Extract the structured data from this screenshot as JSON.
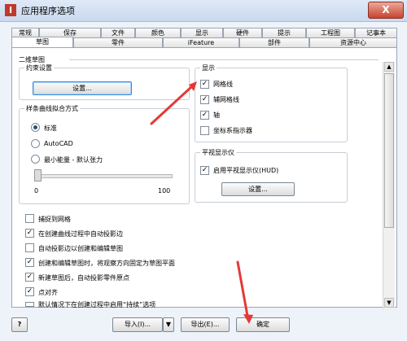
{
  "window": {
    "title": "应用程序选项",
    "close_glyph": "X"
  },
  "tabs_row1": [
    "常规",
    "保存",
    "文件",
    "颜色",
    "显示",
    "硬件",
    "提示",
    "工程图",
    "记事本"
  ],
  "tabs_row2": [
    "草图",
    "零件",
    "iFeature",
    "部件",
    "资源中心"
  ],
  "active_tab": "草图",
  "section_label": "二维草图",
  "constraint": {
    "label": "约束设置",
    "button": "设置..."
  },
  "spline": {
    "label": "样条曲线拟合方式",
    "options": [
      "标准",
      "AutoCAD",
      "最小能量 - 默认张力"
    ],
    "selected": "标准",
    "slider_min": "0",
    "slider_max": "100"
  },
  "display": {
    "label": "显示",
    "items": [
      {
        "label": "网格线",
        "checked": true
      },
      {
        "label": "辅网格线",
        "checked": true
      },
      {
        "label": "轴",
        "checked": true
      },
      {
        "label": "坐标系指示器",
        "checked": false
      }
    ]
  },
  "heads_up": {
    "label": "平视显示仪",
    "checkbox": "启用平视显示仪(HUD)",
    "checked": true,
    "button": "设置..."
  },
  "options": [
    {
      "label": "捕捉到网格",
      "checked": false
    },
    {
      "label": "在创建曲线过程中自动投影边",
      "checked": true
    },
    {
      "label": "自动投影边以创建和编辑草图",
      "checked": false
    },
    {
      "label": "创建和编辑草图时，将观察方向固定为草图平面",
      "checked": true
    },
    {
      "label": "新建草图后，自动投影零件原点",
      "checked": true
    },
    {
      "label": "点对齐",
      "checked": true
    },
    {
      "label": "默认情况下在创建过程中启用“持续”选项",
      "checked": false
    }
  ],
  "footer": {
    "help": "?",
    "import": "导入(I)...",
    "export": "导出(E)...",
    "ok": "确定"
  }
}
